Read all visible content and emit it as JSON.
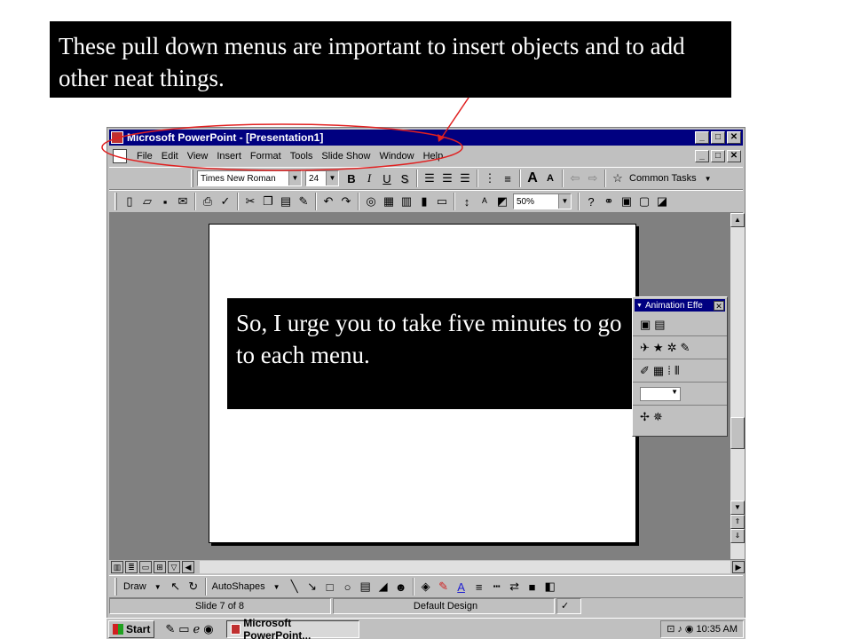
{
  "callouts": {
    "top": "These pull down menus are important to insert objects and to add other neat things.",
    "slide": "So, I urge you to take five minutes to go to each menu."
  },
  "annotation": {
    "color": "#e02020"
  },
  "window": {
    "title": "Microsoft PowerPoint - [Presentation1]",
    "min_glyph": "_",
    "max_glyph": "□",
    "close_glyph": "✕"
  },
  "menus": [
    "File",
    "Edit",
    "View",
    "Insert",
    "Format",
    "Tools",
    "Slide Show",
    "Window",
    "Help"
  ],
  "formatting_toolbar": {
    "font_name": "Times New Roman",
    "font_size": "24",
    "bold": "B",
    "italic": "I",
    "underline": "U",
    "shadow": "S",
    "common_tasks": "Common Tasks"
  },
  "standard_toolbar": {
    "zoom": "50%"
  },
  "animation_panel": {
    "title": "Animation Effe"
  },
  "drawing_toolbar": {
    "draw": "Draw",
    "autoshapes": "AutoShapes"
  },
  "status": {
    "slide": "Slide 7 of 8",
    "design": "Default Design"
  },
  "taskbar": {
    "start": "Start",
    "task": "Microsoft PowerPoint...",
    "clock": "10:35 AM"
  },
  "icons": {
    "app": "powerpoint-icon",
    "new": "new-document-icon",
    "open": "open-folder-icon",
    "save": "save-icon",
    "print": "print-icon",
    "spell": "spelling-icon",
    "cut": "cut-icon",
    "copy": "copy-icon",
    "paste": "paste-icon",
    "undo": "undo-icon",
    "redo": "redo-icon",
    "zoom_help": "help-icon"
  }
}
